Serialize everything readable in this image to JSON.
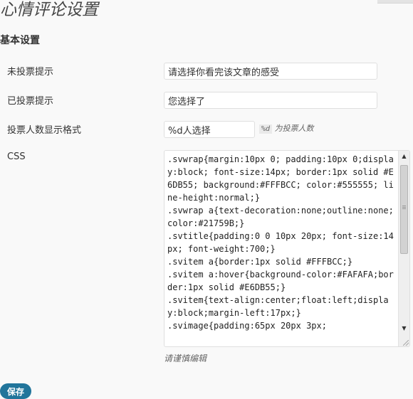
{
  "page": {
    "title": "心情评论设置"
  },
  "section": {
    "title": "基本设置"
  },
  "fields": {
    "not_voted": {
      "label": "未投票提示",
      "value": "请选择你看完该文章的感受"
    },
    "voted": {
      "label": "已投票提示",
      "value": "您选择了"
    },
    "vote_count_format": {
      "label": "投票人数显示格式",
      "value": "%d人选择",
      "hint_code": "%d",
      "hint_text": "为投票人数"
    },
    "css": {
      "label": "CSS",
      "value": ".svwrap{margin:10px 0; padding:10px 0;display:block; font-size:14px; border:1px solid #E6DB55; background:#FFFBCC; color:#555555; line-height:normal;}\n.svwrap a{text-decoration:none;outline:none;color:#21759B;}\n.svtitle{padding:0 0 10px 20px; font-size:14px; font-weight:700;}\n.svitem a{border:1px solid #FFFBCC;}\n.svitem a:hover{background-color:#FAFAFA;border:1px solid #E6DB55;}\n.svitem{text-align:center;float:left;display:block;margin-left:17px;}\n.svimage{padding:65px 20px 3px;",
      "description": "请谨慎编辑"
    }
  },
  "actions": {
    "save_label": "保存"
  },
  "colors": {
    "accent": "#21759b"
  },
  "icons": {
    "scroll_up": "scroll-up-arrow-icon",
    "scroll_down": "scroll-down-arrow-icon",
    "resize": "resize-grip-icon"
  }
}
